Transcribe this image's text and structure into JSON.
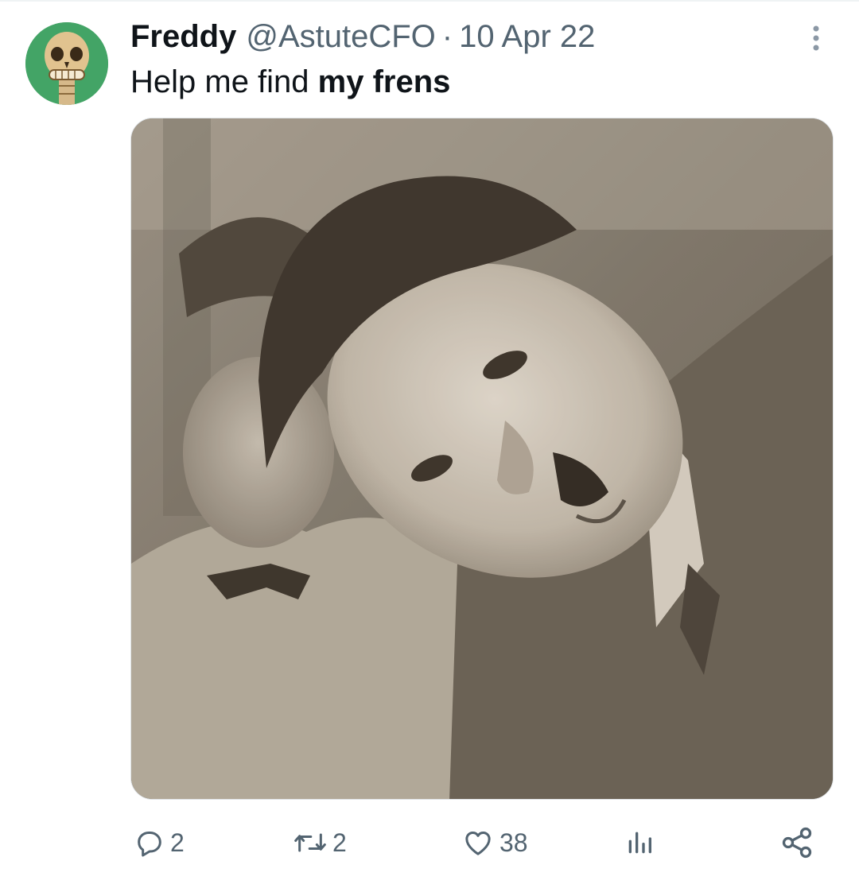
{
  "post": {
    "author": {
      "display_name": "Freddy",
      "handle": "@AstuteCFO"
    },
    "separator": "·",
    "timestamp": "10 Apr 22",
    "text_plain": "Help me find ",
    "text_bold": "my frens",
    "avatar_icon": "skull-avatar",
    "media_icon": "sepia-photo-two-men"
  },
  "actions": {
    "reply": {
      "icon": "reply-icon",
      "count": "2"
    },
    "retweet": {
      "icon": "retweet-icon",
      "count": "2"
    },
    "like": {
      "icon": "heart-icon",
      "count": "38"
    },
    "views": {
      "icon": "views-icon",
      "count": ""
    },
    "share": {
      "icon": "share-icon"
    }
  },
  "colors": {
    "text_primary": "#0f1419",
    "text_secondary": "#536471",
    "avatar_bg": "#3c9a5f"
  }
}
